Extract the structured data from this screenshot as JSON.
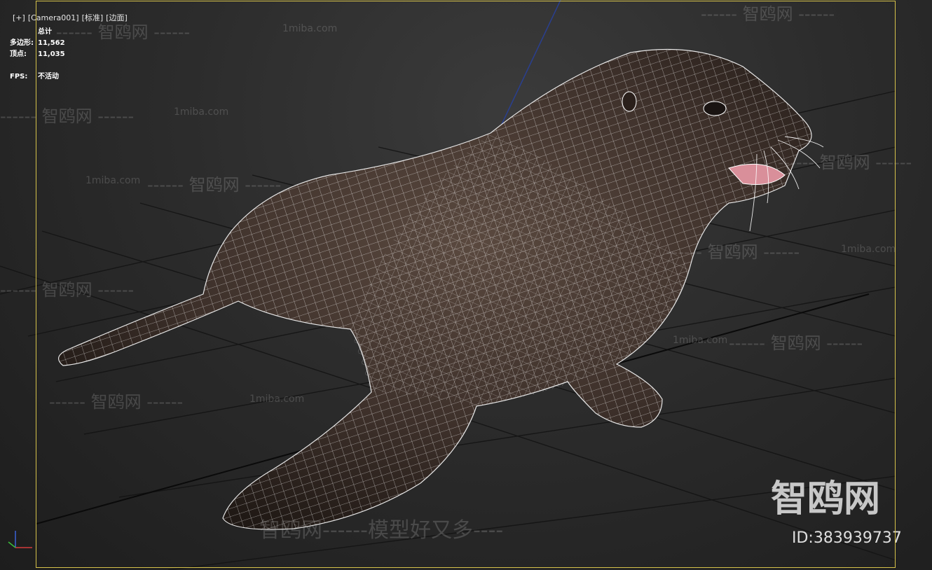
{
  "viewport": {
    "labels": [
      "[+]",
      "[Camera001]",
      "[标准]",
      "[边面]"
    ]
  },
  "stats": {
    "header": "总计",
    "rows": [
      {
        "label": "多边形:",
        "value": "11,562"
      },
      {
        "label": "顶点:",
        "value": "11,035"
      }
    ],
    "fps_label": "FPS:",
    "fps_value": "不活动"
  },
  "watermarks": {
    "site": "1miba.com",
    "brand": "智鸥网",
    "line1": "------ 智鸥网 ------",
    "line2": "智鸥网------模型好又多----",
    "big": "智鸥网",
    "id": "ID:383939737"
  },
  "colors": {
    "frame": "#d6c24a",
    "wire": "#ffffff",
    "body": "#4a3b33",
    "grid": "#111111"
  },
  "icons": {
    "axis": "axis-gizmo-icon"
  }
}
